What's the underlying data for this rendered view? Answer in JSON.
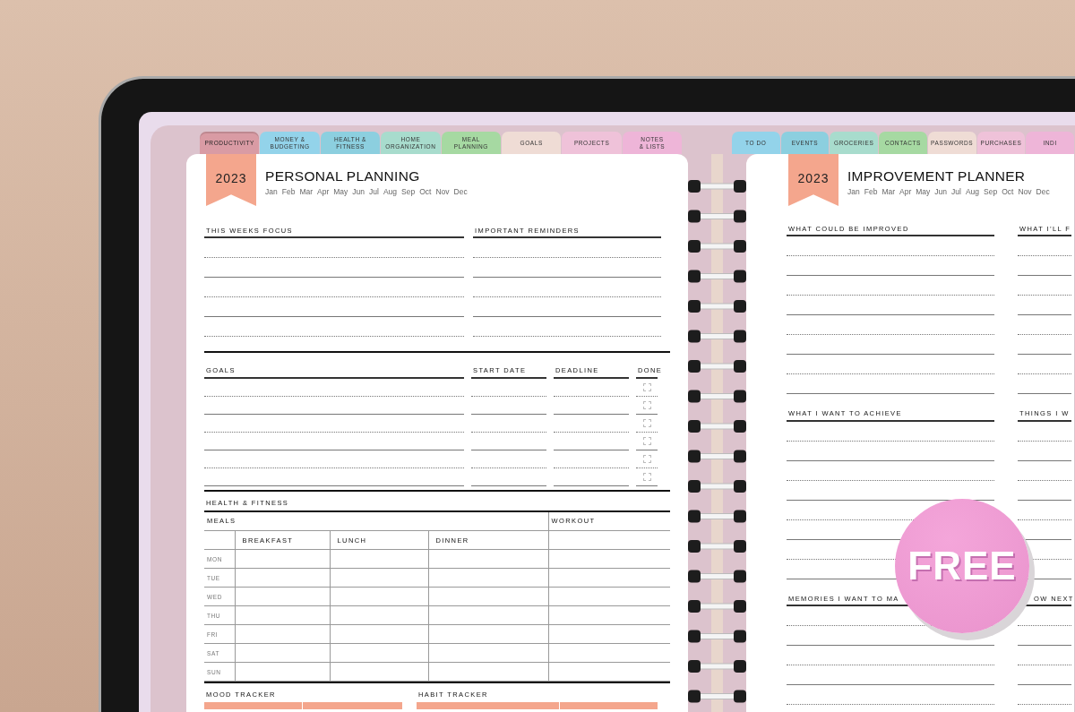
{
  "tabs_left": [
    {
      "label": "PRODUCTIVITY",
      "color": "#d99ba4",
      "selected": true
    },
    {
      "label": "MONEY &\nBUDGETING",
      "color": "#93d3ea",
      "selected": false
    },
    {
      "label": "HEALTH &\nFITNESS",
      "color": "#8ccfdf",
      "selected": false
    },
    {
      "label": "HOME\nORGANIZATION",
      "color": "#a8dccd",
      "selected": false
    },
    {
      "label": "MEAL\nPLANNING",
      "color": "#a6d9a2",
      "selected": false
    },
    {
      "label": "GOALS",
      "color": "#efdcd5",
      "selected": false
    },
    {
      "label": "PROJECTS",
      "color": "#efc2d9",
      "selected": false
    },
    {
      "label": "NOTES\n& LISTS",
      "color": "#eeb5d8",
      "selected": false
    }
  ],
  "tabs_right": [
    {
      "label": "TO DO",
      "color": "#93d3ea",
      "selected": false
    },
    {
      "label": "EVENTS",
      "color": "#8ccfdf",
      "selected": false
    },
    {
      "label": "GROCERIES",
      "color": "#a8dccd",
      "selected": false
    },
    {
      "label": "CONTACTS",
      "color": "#a6d9a2",
      "selected": false
    },
    {
      "label": "PASSWORDS",
      "color": "#efdcd5",
      "selected": false
    },
    {
      "label": "PURCHASES",
      "color": "#efc2d9",
      "selected": false
    },
    {
      "label": "INDI",
      "color": "#eeb5d8",
      "selected": false
    }
  ],
  "left_page": {
    "year": "2023",
    "title": "PERSONAL PLANNING",
    "months": [
      "Jan",
      "Feb",
      "Mar",
      "Apr",
      "May",
      "Jun",
      "Jul",
      "Aug",
      "Sep",
      "Oct",
      "Nov",
      "Dec"
    ],
    "focus_heading": "THIS WEEKS FOCUS",
    "reminders_heading": "IMPORTANT REMINDERS",
    "goals": {
      "columns": [
        "GOALS",
        "START DATE",
        "DEADLINE",
        "DONE"
      ],
      "rows": [
        {
          "done": false
        },
        {
          "done": false
        },
        {
          "done": false
        },
        {
          "done": false
        },
        {
          "done": false
        },
        {
          "done": false
        }
      ]
    },
    "health": {
      "heading": "HEALTH & FITNESS",
      "meals_heading": "MEALS",
      "workout_heading": "WORKOUT",
      "meal_columns": [
        "BREAKFAST",
        "LUNCH",
        "DINNER"
      ],
      "days": [
        "MON",
        "TUE",
        "WED",
        "THU",
        "FRI",
        "SAT",
        "SUN"
      ]
    },
    "trackers": [
      "MOOD TRACKER",
      "HABIT TRACKER"
    ]
  },
  "right_page": {
    "year": "2023",
    "title": "IMPROVEMENT PLANNER",
    "months": [
      "Jan",
      "Feb",
      "Mar",
      "Apr",
      "May",
      "Jun",
      "Jul",
      "Aug",
      "Sep",
      "Oct",
      "Nov",
      "Dec"
    ],
    "sections": [
      {
        "left": "WHAT COULD BE IMPROVED",
        "right": "WHAT I’LL F"
      },
      {
        "left": "WHAT I WANT TO ACHIEVE",
        "right": "THINGS I W"
      },
      {
        "left": "MEMORIES I WANT TO MA",
        "right": "OW NEXT"
      }
    ]
  },
  "badge": {
    "text": "FREE"
  }
}
